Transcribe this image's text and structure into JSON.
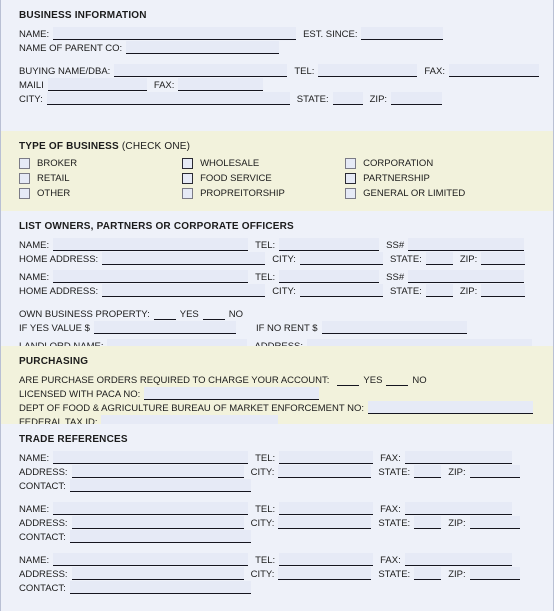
{
  "page": {
    "background_color": "#eef1f9",
    "tinted_section_color": "#f2f2dc",
    "field_fill_color": "#e6eaf6",
    "text_color": "#1b1b1b"
  },
  "business_information": {
    "title": "BUSINESS INFORMATION",
    "labels": {
      "name": "NAME:",
      "est_since": "EST. SINCE:",
      "parent_co": "NAME OF PARENT CO:",
      "buying_name_dba": "BUYING NAME/DBA:",
      "tel": "TEL:",
      "fax": "FAX:",
      "mailing": "MAILI",
      "mailing_fax": "FAX:",
      "city": "CITY:",
      "state": "STATE:",
      "zip": "ZIP:"
    },
    "values": {
      "name": "",
      "est_since": "",
      "parent_co": "",
      "buying_name_dba": "",
      "tel": "",
      "fax": "",
      "mailing": "",
      "mailing_fax": "",
      "city": "",
      "state": "",
      "zip": ""
    }
  },
  "type_of_business": {
    "title": "TYPE OF BUSINESS",
    "subtitle": "(CHECK ONE)",
    "columns": [
      {
        "options": [
          {
            "label": "BROKER",
            "checked": false
          },
          {
            "label": "RETAIL",
            "checked": false
          },
          {
            "label": "OTHER",
            "checked": false
          }
        ]
      },
      {
        "options": [
          {
            "label": "WHOLESALE",
            "checked": false
          },
          {
            "label": "FOOD SERVICE",
            "checked": false
          },
          {
            "label": "PROPREITORSHIP",
            "checked": false
          }
        ]
      },
      {
        "options": [
          {
            "label": "CORPORATION",
            "checked": false
          },
          {
            "label": "PARTNERSHIP",
            "checked": false
          },
          {
            "label": "GENERAL OR LIMITED",
            "checked": false
          }
        ]
      }
    ]
  },
  "owners": {
    "title": "LIST OWNERS, PARTNERS OR CORPORATE OFFICERS",
    "labels": {
      "name": "NAME:",
      "tel": "TEL:",
      "ss": "SS#",
      "home_address": "HOME ADDRESS:",
      "city": "CITY:",
      "state": "STATE:",
      "zip": "ZIP:",
      "own_property": "OWN BUSINESS PROPERTY:",
      "yes": "YES",
      "no": "NO",
      "if_yes_value": "IF YES     VALUE $",
      "if_no_rent": "IF NO      RENT $",
      "landlord_name": "LANDLORD NAME:",
      "address": "ADDRESS:"
    },
    "entries": [
      {
        "name": "",
        "tel": "",
        "ss": "",
        "home_address": "",
        "city": "",
        "state": "",
        "zip": ""
      },
      {
        "name": "",
        "tel": "",
        "ss": "",
        "home_address": "",
        "city": "",
        "state": "",
        "zip": ""
      }
    ],
    "own_property_yes": "",
    "own_property_no": "",
    "value_amount": "",
    "rent_amount": "",
    "landlord_name": "",
    "landlord_address": ""
  },
  "purchasing": {
    "title": "PURCHASING",
    "labels": {
      "po_required": "ARE PURCHASE ORDERS REQUIRED TO CHARGE YOUR ACCOUNT:",
      "yes": "YES",
      "no": "NO",
      "paca": "LICENSED WITH PACA NO:",
      "dept_food": "DEPT OF FOOD & AGRICULTURE BUREAU OF MARKET ENFORCEMENT NO:",
      "federal_tax_id": "FEDERAL TAX ID:"
    },
    "values": {
      "po_yes": "",
      "po_no": "",
      "paca": "",
      "dept_food": "",
      "federal_tax_id": ""
    }
  },
  "trade_references": {
    "title": "TRADE REFERENCES",
    "labels": {
      "name": "NAME:",
      "tel": "TEL:",
      "fax": "FAX:",
      "address": "ADDRESS:",
      "city": "CITY:",
      "state": "STATE:",
      "zip": "ZIP:",
      "contact": "CONTACT:"
    },
    "entries": [
      {
        "name": "",
        "tel": "",
        "fax": "",
        "address": "",
        "city": "",
        "state": "",
        "zip": "",
        "contact": ""
      },
      {
        "name": "",
        "tel": "",
        "fax": "",
        "address": "",
        "city": "",
        "state": "",
        "zip": "",
        "contact": ""
      },
      {
        "name": "",
        "tel": "",
        "fax": "",
        "address": "",
        "city": "",
        "state": "",
        "zip": "",
        "contact": ""
      }
    ]
  }
}
